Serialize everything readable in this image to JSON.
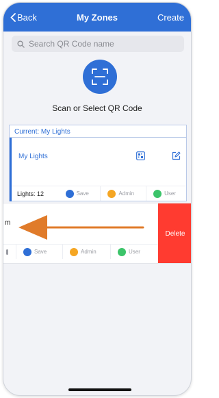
{
  "navbar": {
    "back_label": "Back",
    "title": "My Zones",
    "create_label": "Create"
  },
  "search": {
    "placeholder": "Search QR Code name"
  },
  "scan": {
    "label": "Scan or Select QR Code"
  },
  "current": {
    "header": "Current: My Lights",
    "zone_name": "My Lights",
    "lights_count": "Lights: 12",
    "actions": {
      "save": "Save",
      "admin": "Admin",
      "user": "User"
    }
  },
  "swiped_row": {
    "name_fragment": "m",
    "actions": {
      "save": "Save",
      "admin": "Admin",
      "user": "User"
    },
    "delete_label": "Delete"
  },
  "colors": {
    "accent": "#2f6fd6",
    "save": "#2f6fd6",
    "admin": "#f5a623",
    "user": "#3cc46a",
    "delete": "#ff3b30",
    "arrow": "#e07b2a"
  }
}
